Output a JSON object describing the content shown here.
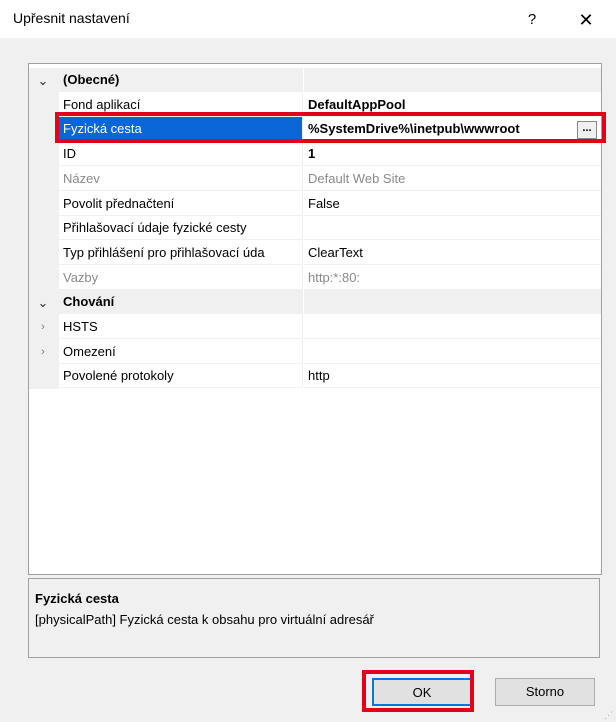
{
  "window": {
    "title": "Upřesnit nastavení",
    "help_label": "?",
    "close_label": "✕"
  },
  "grid": {
    "rows": [
      {
        "kind": "category",
        "expanded": true,
        "name": "(Obecné)",
        "value": ""
      },
      {
        "kind": "property",
        "name": "Fond aplikací",
        "value": "DefaultAppPool",
        "value_bold": true
      },
      {
        "kind": "property",
        "name": "Fyzická cesta",
        "value": "%SystemDrive%\\inetpub\\wwwroot",
        "selected": true,
        "has_ellipsis": true
      },
      {
        "kind": "property",
        "name": "ID",
        "value": "1",
        "value_bold": true
      },
      {
        "kind": "property",
        "name": "Název",
        "value": "Default Web Site",
        "readonly": true
      },
      {
        "kind": "property",
        "name": "Povolit přednačtení",
        "value": "False"
      },
      {
        "kind": "property",
        "name": "Přihlašovací údaje fyzické cesty",
        "value": ""
      },
      {
        "kind": "property",
        "name": "Typ přihlášení pro přihlašovací úda",
        "value": "ClearText"
      },
      {
        "kind": "property",
        "name": "Vazby",
        "value": "http:*:80:",
        "readonly": true
      },
      {
        "kind": "category",
        "expanded": true,
        "name": "Chování",
        "value": ""
      },
      {
        "kind": "subgroup",
        "collapsed": true,
        "name": "HSTS",
        "value": ""
      },
      {
        "kind": "subgroup",
        "collapsed": true,
        "name": "Omezení",
        "value": ""
      },
      {
        "kind": "property",
        "name": "Povolené protokoly",
        "value": "http"
      }
    ],
    "ellipsis_label": "..."
  },
  "description": {
    "title": "Fyzická cesta",
    "text": "[physicalPath] Fyzická cesta k obsahu pro virtuální adresář"
  },
  "buttons": {
    "ok_label": "OK",
    "cancel_label": "Storno"
  },
  "colors": {
    "selection": "#0a66d6",
    "annotation": "#e3001b"
  }
}
